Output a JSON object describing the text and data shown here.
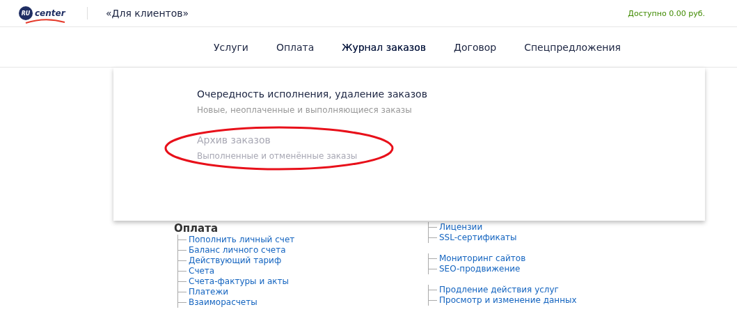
{
  "header": {
    "logo": {
      "badge": "RU",
      "word": "center"
    },
    "title": "«Для клиентов»",
    "balance": "Доступно 0.00 руб."
  },
  "nav": [
    {
      "label": "Услуги",
      "selected": false
    },
    {
      "label": "Оплата",
      "selected": false
    },
    {
      "label": "Журнал заказов",
      "selected": true
    },
    {
      "label": "Договор",
      "selected": false
    },
    {
      "label": "Спецпредложения",
      "selected": false
    }
  ],
  "dropdown": {
    "items": [
      {
        "title": "Очередность исполнения, удаление заказов",
        "subtitle": "Новые, неоплаченные и выполняющиеся заказы",
        "disabled": false,
        "circled": false
      },
      {
        "title": "Архив заказов",
        "subtitle": "Выполненные и отменённые заказы",
        "disabled": true,
        "circled": true
      }
    ]
  },
  "sitemap": {
    "left": {
      "heading": "Оплата",
      "groups": [
        [
          "Пополнить личный счет",
          "Баланс личного счета",
          "Действующий тариф",
          "Счета",
          "Счета-фактуры и акты",
          "Платежи",
          "Взаиморасчеты"
        ]
      ]
    },
    "right": {
      "groups": [
        [
          "Лицензии",
          "SSL-сертификаты"
        ],
        [
          "Мониторинг сайтов",
          "SEO-продвижение"
        ],
        [
          "Продление действия услуг",
          "Просмотр и изменение данных"
        ]
      ]
    }
  }
}
